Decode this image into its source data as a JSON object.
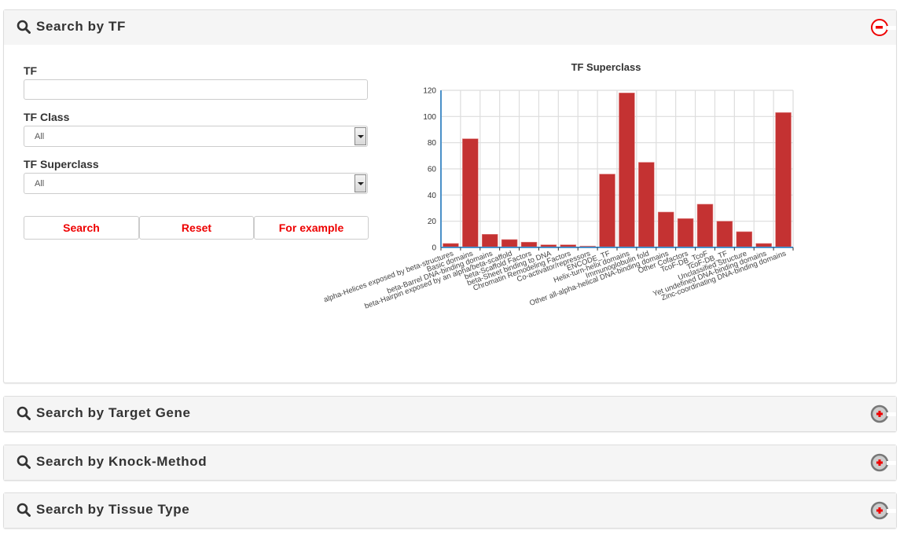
{
  "panels": [
    {
      "title": "Search by TF",
      "icon": "search-icon",
      "state": "expanded"
    },
    {
      "title": "Search by Target Gene",
      "icon": "search-icon",
      "state": "collapsed"
    },
    {
      "title": "Search by Knock-Method",
      "icon": "search-icon",
      "state": "collapsed"
    },
    {
      "title": "Search by Tissue Type",
      "icon": "search-icon",
      "state": "collapsed"
    }
  ],
  "form": {
    "tf_label": "TF",
    "tf_value": "",
    "tf_class_label": "TF Class",
    "tf_class_value": "All",
    "tf_superclass_label": "TF Superclass",
    "tf_superclass_value": "All",
    "buttons": {
      "search": "Search",
      "reset": "Reset",
      "example": "For example"
    }
  },
  "colors": {
    "accent": "#e00000",
    "bar": "#c43232",
    "axis": "#4a90c8"
  },
  "chart_data": {
    "type": "bar",
    "title": "TF Superclass",
    "xlabel": "",
    "ylabel": "",
    "ylim": [
      0,
      120
    ],
    "yticks": [
      0,
      20,
      40,
      60,
      80,
      100,
      120
    ],
    "grid": true,
    "categories": [
      "alpha-Helices exposed by beta-structures",
      "Basic domains",
      "beta-Barrel DNA-binding domains",
      "beta-Hairpin exposed by an alpha/beta-scaffold",
      "beta-Scaffold Factors",
      "beta-Sheet binding to DNA",
      "Chromatin Remodeling Factors",
      "Co-activator/repressors",
      "ENCODE_TF",
      "Helix-turn-helix domains",
      "Immunoglobulin fold",
      "Other all-alpha-helical DNA-binding domains",
      "Other Cofactors",
      "TcoF-DB_TcoF",
      "TcoF-DB_TF",
      "Unclassified Structure",
      "Yet undefined DNA-binding domains",
      "Zinc-coordinating DNA-binding domains"
    ],
    "values": [
      3,
      83,
      10,
      6,
      4,
      2,
      2,
      1,
      56,
      118,
      65,
      27,
      22,
      33,
      20,
      12,
      3,
      103
    ]
  }
}
